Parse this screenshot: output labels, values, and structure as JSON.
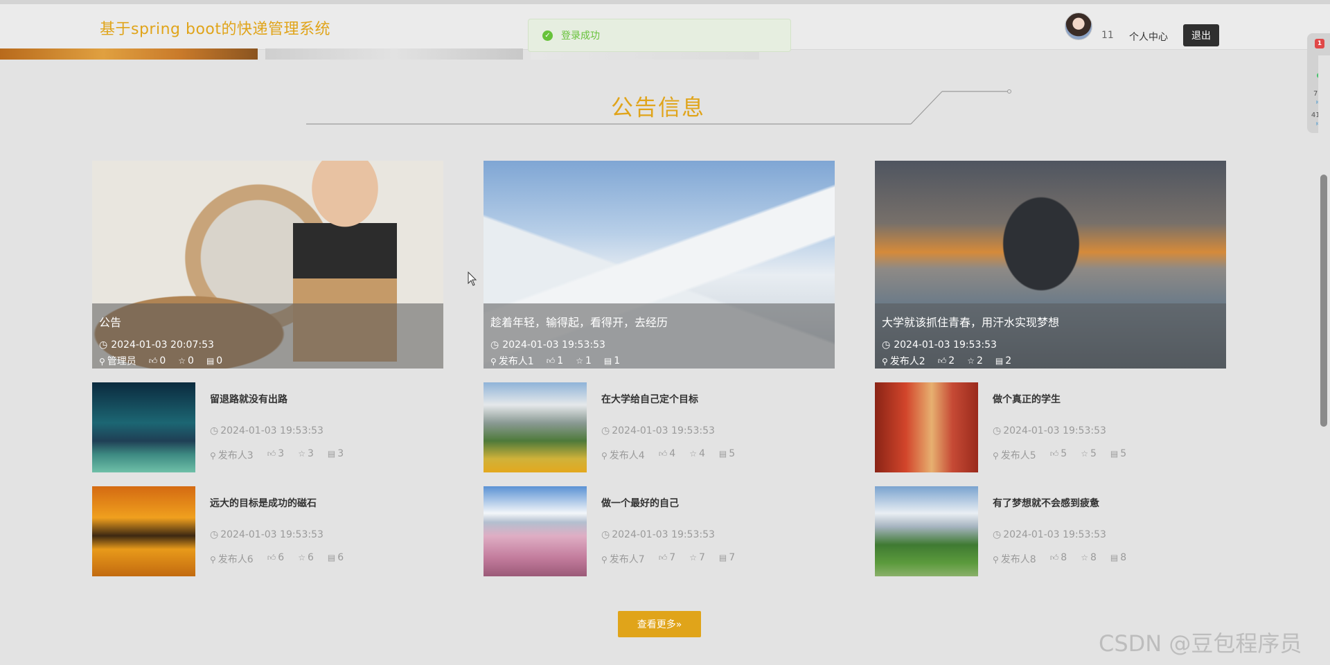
{
  "header": {
    "site_title": "基于spring boot的快递管理系统",
    "username": "11",
    "user_center_label": "个人中心",
    "logout_label": "退出"
  },
  "toast": {
    "message": "登录成功",
    "type": "success"
  },
  "section": {
    "title": "公告信息"
  },
  "icons": {
    "clock": "clock-icon",
    "user": "user-icon",
    "like": "thumbs-up-icon",
    "star": "star-icon",
    "comment": "comment-icon"
  },
  "features": [
    {
      "title": "公告",
      "date": "2024-01-03 20:07:53",
      "author": "管理员",
      "likes": "0",
      "stars": "0",
      "comments": "0"
    },
    {
      "title": "趁着年轻，输得起，看得开，去经历",
      "date": "2024-01-03 19:53:53",
      "author": "发布人1",
      "likes": "1",
      "stars": "1",
      "comments": "1"
    },
    {
      "title": "大学就该抓住青春，用汗水实现梦想",
      "date": "2024-01-03 19:53:53",
      "author": "发布人2",
      "likes": "2",
      "stars": "2",
      "comments": "2"
    }
  ],
  "items": [
    {
      "title": "留退路就没有出路",
      "date": "2024-01-03 19:53:53",
      "author": "发布人3",
      "likes": "3",
      "stars": "3",
      "comments": "3"
    },
    {
      "title": "在大学给自己定个目标",
      "date": "2024-01-03 19:53:53",
      "author": "发布人4",
      "likes": "4",
      "stars": "4",
      "comments": "5"
    },
    {
      "title": "做个真正的学生",
      "date": "2024-01-03 19:53:53",
      "author": "发布人5",
      "likes": "5",
      "stars": "5",
      "comments": "5"
    },
    {
      "title": "远大的目标是成功的磁石",
      "date": "2024-01-03 19:53:53",
      "author": "发布人6",
      "likes": "6",
      "stars": "6",
      "comments": "6"
    },
    {
      "title": "做一个最好的自己",
      "date": "2024-01-03 19:53:53",
      "author": "发布人7",
      "likes": "7",
      "stars": "7",
      "comments": "7"
    },
    {
      "title": "有了梦想就不会感到疲惫",
      "date": "2024-01-03 19:53:53",
      "author": "发布人8",
      "likes": "8",
      "stars": "8",
      "comments": "8"
    }
  ],
  "more_button_label": "查看更多»",
  "float_widget": {
    "badge": "1",
    "upload": "7.3",
    "upload_unit": "K/s",
    "download": "41.6",
    "download_unit": "K/s"
  },
  "watermark": "CSDN @豆包程序员",
  "colors": {
    "accent": "#e0a41a",
    "success": "#67c23a",
    "dark_button": "#2f2f2f"
  }
}
